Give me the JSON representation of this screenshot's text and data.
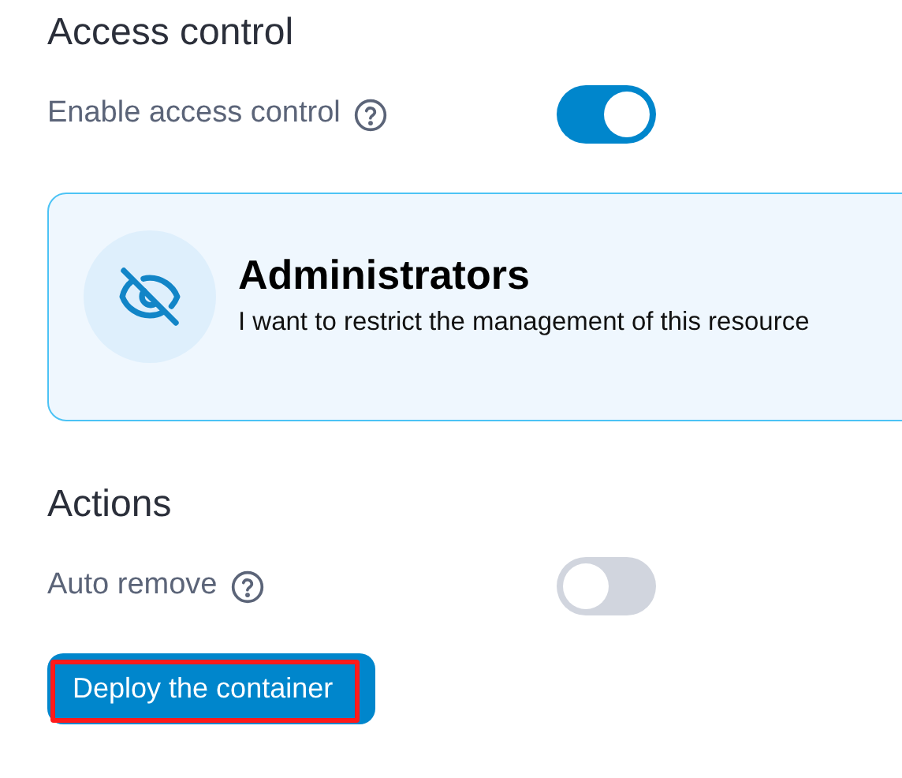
{
  "access_control": {
    "title": "Access control",
    "toggle": {
      "label": "Enable access control",
      "on": true
    },
    "option": {
      "title": "Administrators",
      "description": "I want to restrict the management of this resource",
      "selected": true
    }
  },
  "actions": {
    "title": "Actions",
    "toggle": {
      "label": "Auto remove",
      "on": false
    },
    "button": {
      "label": "Deploy the container",
      "highlighted": true
    }
  }
}
